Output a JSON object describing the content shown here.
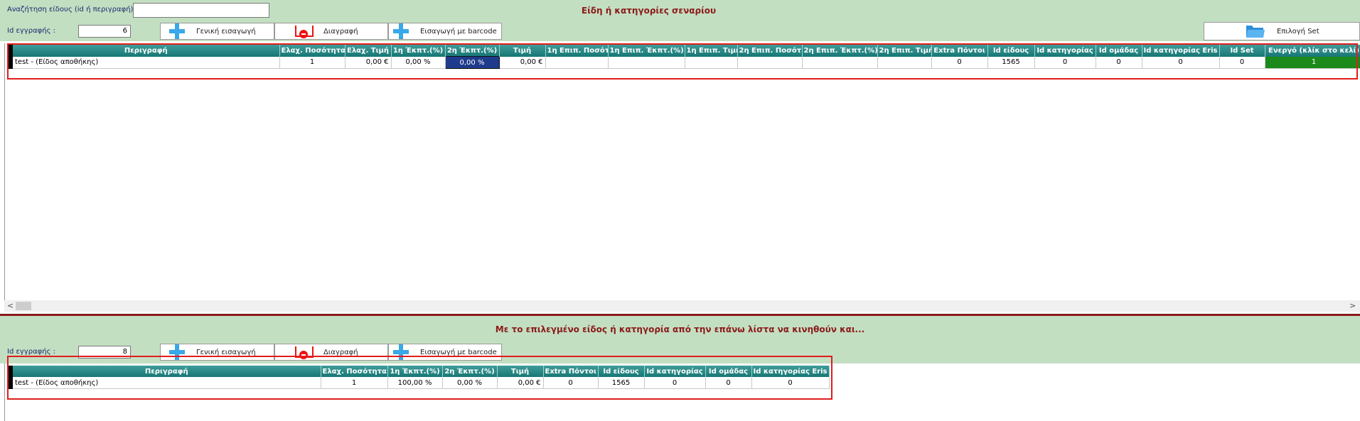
{
  "top": {
    "search_label": "Αναζήτηση είδους (id ή περιγραφή)",
    "search_value": "",
    "section_title": "Είδη ή κατηγορίες σεναρίου",
    "id_label": "Id εγγραφής :",
    "id_value": "6",
    "btn_general": "Γενική εισαγωγή",
    "btn_delete": "Διαγραφή",
    "btn_barcode": "Εισαγωγή με barcode",
    "btn_select_set": "Επιλογή Set",
    "columns": [
      "Περιγραφή",
      "Ελαχ. Ποσότητα",
      "Ελαχ. Τιμή",
      "1η Έκπτ.(%)",
      "2η Έκπτ.(%)",
      "Τιμή",
      "1η Επιπ. Ποσότ.",
      "1η Επιπ. Έκπτ.(%)",
      "1η Επιπ. Τιμή",
      "2η Επιπ. Ποσότ.",
      "2η Επιπ. Έκπτ.(%)",
      "2η Επιπ. Τιμή",
      "Extra Πόντοι",
      "Id είδους",
      "Id κατηγορίας",
      "Id ομάδας",
      "Id κατηγορίας Eris",
      "Id Set",
      "Ενεργό (κλίκ στο κελί)"
    ],
    "row": [
      "test - (Είδος αποθήκης)",
      "1",
      "0,00 €",
      "0,00 %",
      "0,00 %",
      "0,00 €",
      "",
      "",
      "",
      "",
      "",
      "",
      "0",
      "1565",
      "0",
      "0",
      "0",
      "0",
      "1"
    ]
  },
  "bottom": {
    "section_title": "Με το επιλεγμένο είδος ή κατηγορία από την επάνω λίστα να κινηθούν και...",
    "id_label": "Id εγγραφής :",
    "id_value": "8",
    "btn_general": "Γενική εισαγωγή",
    "btn_delete": "Διαγραφή",
    "btn_barcode": "Εισαγωγή με barcode",
    "columns": [
      "Περιγραφή",
      "Ελαχ. Ποσότητα",
      "1η Έκπτ.(%)",
      "2η Έκπτ.(%)",
      "Τιμή",
      "Extra Πόντοι",
      "Id είδους",
      "Id κατηγορίας",
      "Id ομάδας",
      "Id κατηγορίας Eris"
    ],
    "row": [
      "test - (Είδος αποθήκης)",
      "1",
      "100,00 %",
      "0,00 %",
      "0,00 €",
      "0",
      "1565",
      "0",
      "0",
      "0"
    ]
  },
  "colors": {
    "section_bar": "#c3dfc2",
    "header": "#177774",
    "title": "#8b1a1a",
    "active": "#1b8a1b",
    "selected": "#1f3b8c",
    "highlight": "#e01d1d"
  }
}
